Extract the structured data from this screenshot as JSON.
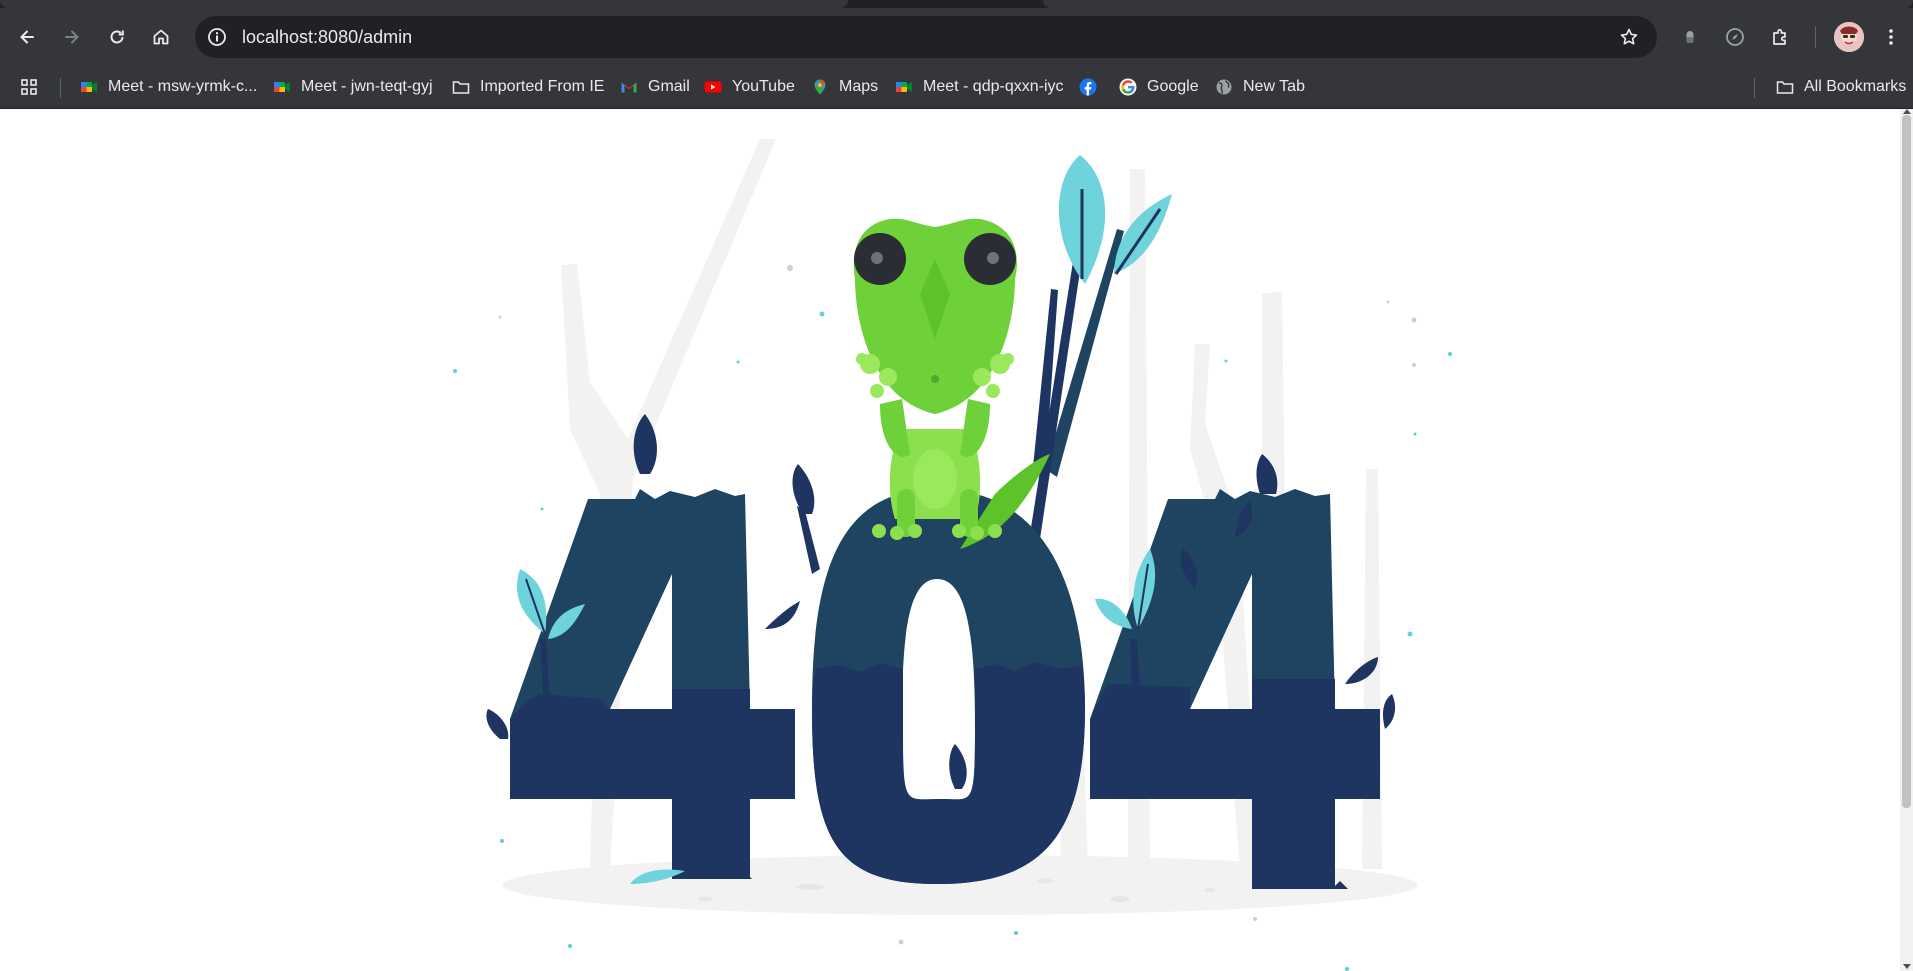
{
  "browser": {
    "url": "localhost:8080/admin",
    "toolbar_icons": [
      "back-arrow-icon",
      "forward-arrow-icon",
      "reload-icon",
      "home-icon",
      "site-info-icon",
      "bookmark-star-icon",
      "extension-puzzle-icon",
      "profile-avatar",
      "more-menu-icon"
    ]
  },
  "bookmarks": {
    "items": [
      {
        "label": "Meet - msw-yrmk-c...",
        "icon": "google-meet-icon"
      },
      {
        "label": "Meet - jwn-teqt-gyj",
        "icon": "google-meet-icon"
      },
      {
        "label": "Imported From IE",
        "icon": "folder-icon"
      },
      {
        "label": "Gmail",
        "icon": "gmail-icon"
      },
      {
        "label": "YouTube",
        "icon": "youtube-icon"
      },
      {
        "label": "Maps",
        "icon": "maps-pin-icon"
      },
      {
        "label": "Meet - qdp-qxxn-iyc",
        "icon": "google-meet-icon"
      },
      {
        "label": "",
        "icon": "facebook-icon"
      },
      {
        "label": "Google",
        "icon": "google-icon"
      },
      {
        "label": "New Tab",
        "icon": "globe-icon"
      }
    ],
    "all_bookmarks": "All Bookmarks"
  },
  "page": {
    "illustration": "404-illustration",
    "error_code": "404",
    "colors": {
      "dark_navy": "#1e3461",
      "teal_navy": "#1e4461",
      "lizard_green": "#6fd13a",
      "leaf_cyan": "#6fd3dc"
    }
  }
}
